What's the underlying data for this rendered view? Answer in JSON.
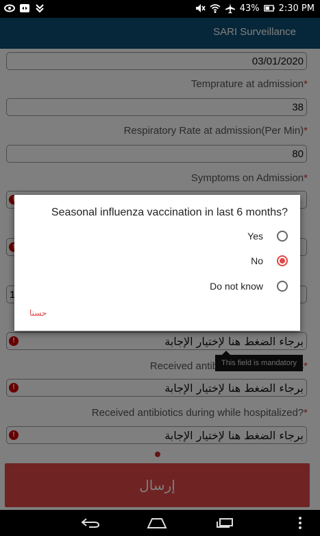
{
  "status_bar": {
    "battery": "43%",
    "time": "2:30 PM",
    "left_icons": [
      "eye-icon",
      "teamviewer-icon",
      "download-icon"
    ],
    "right_icons": [
      "mute-icon",
      "wifi-icon",
      "airplane-icon",
      "battery-icon"
    ]
  },
  "app_bar": {
    "title": "SARI Surveillance"
  },
  "form": {
    "date_value": "03/01/2020",
    "temperature": {
      "label": "Temprature at admission",
      "value": "38"
    },
    "respiratory": {
      "label": "Respiratory Rate at admission(Per Min)",
      "value": "80"
    },
    "symptoms": {
      "label": "Symptoms on Admission"
    },
    "hidden_value_fragment": "1",
    "antibiotics_3days": {
      "label": "Received antibiotics within 3 days",
      "placeholder": "برجاء الضغط هنا لإختيار الإجابة"
    },
    "antibiotics_hospital": {
      "label": "Received antibiotics during while hospitalized?",
      "placeholder": "برجاء الضغط هنا لإختيار الإجابة"
    },
    "field_above": {
      "placeholder": "برجاء الضغط هنا لإختيار الإجابة"
    },
    "required_mark": "*",
    "tooltip": "This field is mandatory",
    "submit_label": "إرسال"
  },
  "dialog": {
    "question": "Seasonal influenza vaccination in last 6 months?",
    "options": [
      {
        "label": "Yes",
        "selected": false
      },
      {
        "label": "No",
        "selected": true
      },
      {
        "label": "Do not know",
        "selected": false
      }
    ],
    "ok_label": "حسنا"
  },
  "colors": {
    "accent": "#e04747",
    "appbar": "#0d4d72",
    "error": "#d00000"
  }
}
